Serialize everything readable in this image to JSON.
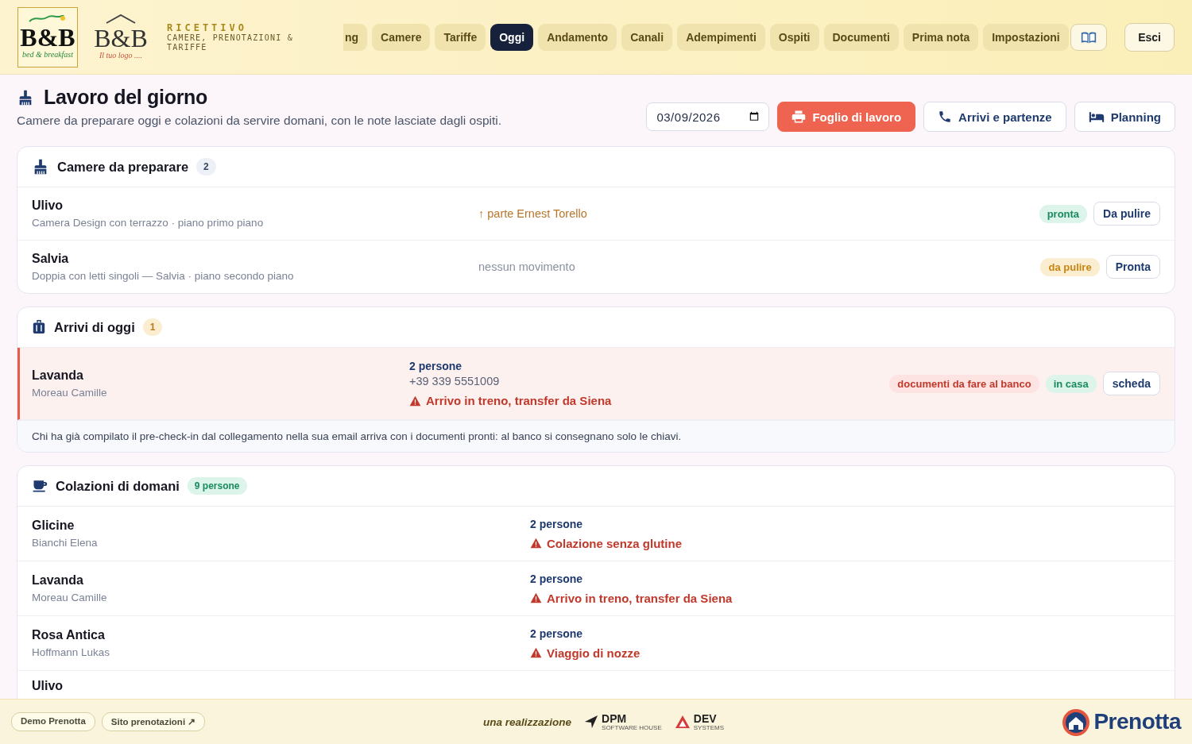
{
  "header": {
    "logos": [
      {
        "kind": "regional",
        "title": "B&B",
        "caption": "bed & breakfast"
      },
      {
        "kind": "placeholder",
        "title": "B&B",
        "caption": "Il tuo logo ...."
      }
    ],
    "brand": {
      "title": "RICETTIVO",
      "subtitle": "CAMERE, PRENOTAZIONI & TARIFFE"
    },
    "tabs": [
      {
        "label": "ng",
        "selected": false
      },
      {
        "label": "Camere",
        "selected": false
      },
      {
        "label": "Tariffe",
        "selected": false
      },
      {
        "label": "Oggi",
        "selected": true
      },
      {
        "label": "Andamento",
        "selected": false
      },
      {
        "label": "Canali",
        "selected": false
      },
      {
        "label": "Adempimenti",
        "selected": false
      },
      {
        "label": "Ospiti",
        "selected": false
      },
      {
        "label": "Documenti",
        "selected": false
      },
      {
        "label": "Prima nota",
        "selected": false
      },
      {
        "label": "Impostazioni",
        "selected": false
      }
    ],
    "logout": "Esci"
  },
  "page": {
    "title": "Lavoro del giorno",
    "subtitle": "Camere da preparare oggi e colazioni da servire domani, con le note lasciate dagli ospiti.",
    "date": "03/09/2026",
    "actions": [
      {
        "label": "Foglio di lavoro",
        "kind": "print"
      },
      {
        "label": "Arrivi e partenze",
        "kind": "phone"
      },
      {
        "label": "Planning",
        "kind": "bed"
      }
    ]
  },
  "sections": [
    {
      "kind": "rooms",
      "title": "Camere da preparare",
      "count": "2",
      "rows": [
        {
          "name": "Ulivo",
          "detail": "Camera Design con terrazzo · piano primo piano",
          "movement": {
            "text": "↑ parte Ernest Torello",
            "kind": "departure"
          },
          "status": {
            "label": "pronta",
            "kind": "ready"
          },
          "action": "Da pulire"
        },
        {
          "name": "Salvia",
          "detail": "Doppia con letti singoli — Salvia · piano secondo piano",
          "movement": {
            "text": "nessun movimento",
            "kind": "none"
          },
          "status": {
            "label": "da pulire",
            "kind": "dirty"
          },
          "action": "Pronta"
        }
      ]
    },
    {
      "kind": "arrivals",
      "title": "Arrivi di oggi",
      "count": "1",
      "rows": [
        {
          "name": "Lavanda",
          "guest": "Moreau Camille",
          "alert": true,
          "persons": "2 persone",
          "phone": "+39 339 5551009",
          "note": "Arrivo in treno, transfer da Siena",
          "tags": [
            {
              "label": "documenti da fare al banco",
              "kind": "warning"
            },
            {
              "label": "in casa",
              "kind": "ready"
            }
          ],
          "action": "scheda"
        }
      ],
      "footnote": "Chi ha già compilato il pre-check-in dal collegamento nella sua email arriva con i documenti pronti: al banco si consegnano solo le chiavi."
    },
    {
      "kind": "breakfasts",
      "title": "Colazioni di domani",
      "count": "9 persone",
      "rows": [
        {
          "name": "Glicine",
          "guest": "Bianchi Elena",
          "persons": "2 persone",
          "note": "Colazione senza glutine"
        },
        {
          "name": "Lavanda",
          "guest": "Moreau Camille",
          "persons": "2 persone",
          "note": "Arrivo in treno, transfer da Siena"
        },
        {
          "name": "Rosa Antica",
          "guest": "Hoffmann Lukas",
          "persons": "2 persone",
          "note": "Viaggio di nozze"
        },
        {
          "name": "Ulivo"
        }
      ]
    }
  ],
  "footer": {
    "links": [
      {
        "label": "Demo Prenotta"
      },
      {
        "label": "Sito prenotazioni ↗"
      }
    ],
    "credit": "una realizzazione",
    "partners": [
      {
        "name": "DPM",
        "tagline": "SOFTWARE HOUSE",
        "kind": "dpm"
      },
      {
        "name": "DEV",
        "tagline": "SYSTEMS",
        "kind": "dev"
      }
    ],
    "product": "Prenotta"
  }
}
